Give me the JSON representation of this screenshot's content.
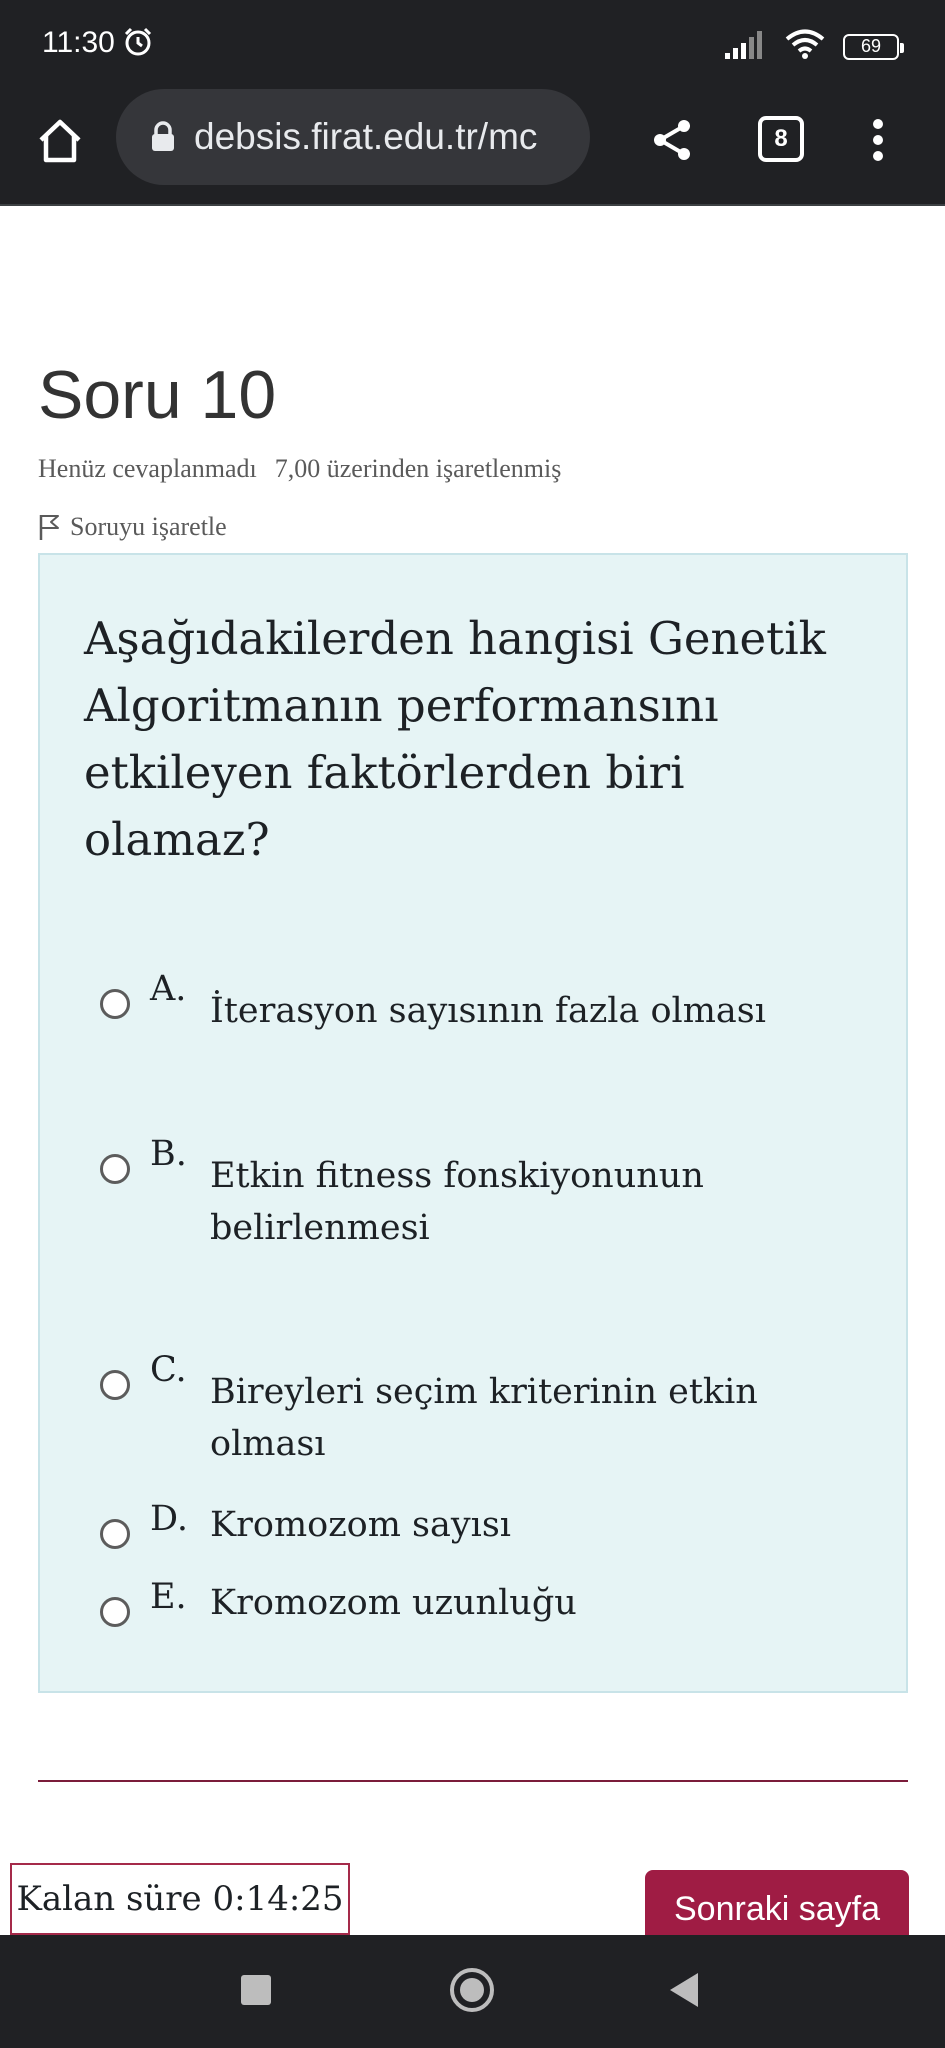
{
  "status_bar": {
    "time": "11:30",
    "battery": "69",
    "icons": [
      "alarm-icon",
      "signal-icon",
      "wifi-icon",
      "battery-icon"
    ]
  },
  "browser": {
    "url": "debsis.firat.edu.tr/mc",
    "tab_count": "8",
    "icons": [
      "home-icon",
      "lock-icon",
      "share-icon",
      "tabs-icon",
      "more-vert-icon"
    ]
  },
  "question": {
    "title": "Soru 10",
    "state": "Henüz cevaplanmadı",
    "marks": "7,00 üzerinden işaretlenmiş",
    "flag_label": "Soruyu işaretle",
    "text": "Aşağıdakilerden hangisi Genetik Algoritmanın performansını etkileyen faktörlerden biri olamaz?",
    "options": [
      {
        "letter": "A.",
        "text": "İterasyon sayısının fazla olması"
      },
      {
        "letter": "B.",
        "text": "Etkin fitness fonskiyonunun belirlenmesi"
      },
      {
        "letter": "C.",
        "text": "Bireyleri seçim kriterinin etkin olması"
      },
      {
        "letter": "D.",
        "text": "Kromozom sayısı"
      },
      {
        "letter": "E.",
        "text": "Kromozom uzunluğu"
      }
    ]
  },
  "footer": {
    "timer": "Kalan süre 0:14:25",
    "next_label": "Sonraki sayfa"
  },
  "colors": {
    "browser_bg": "#202124",
    "question_box_bg": "#e6f4f5",
    "accent": "#9f1c44"
  }
}
